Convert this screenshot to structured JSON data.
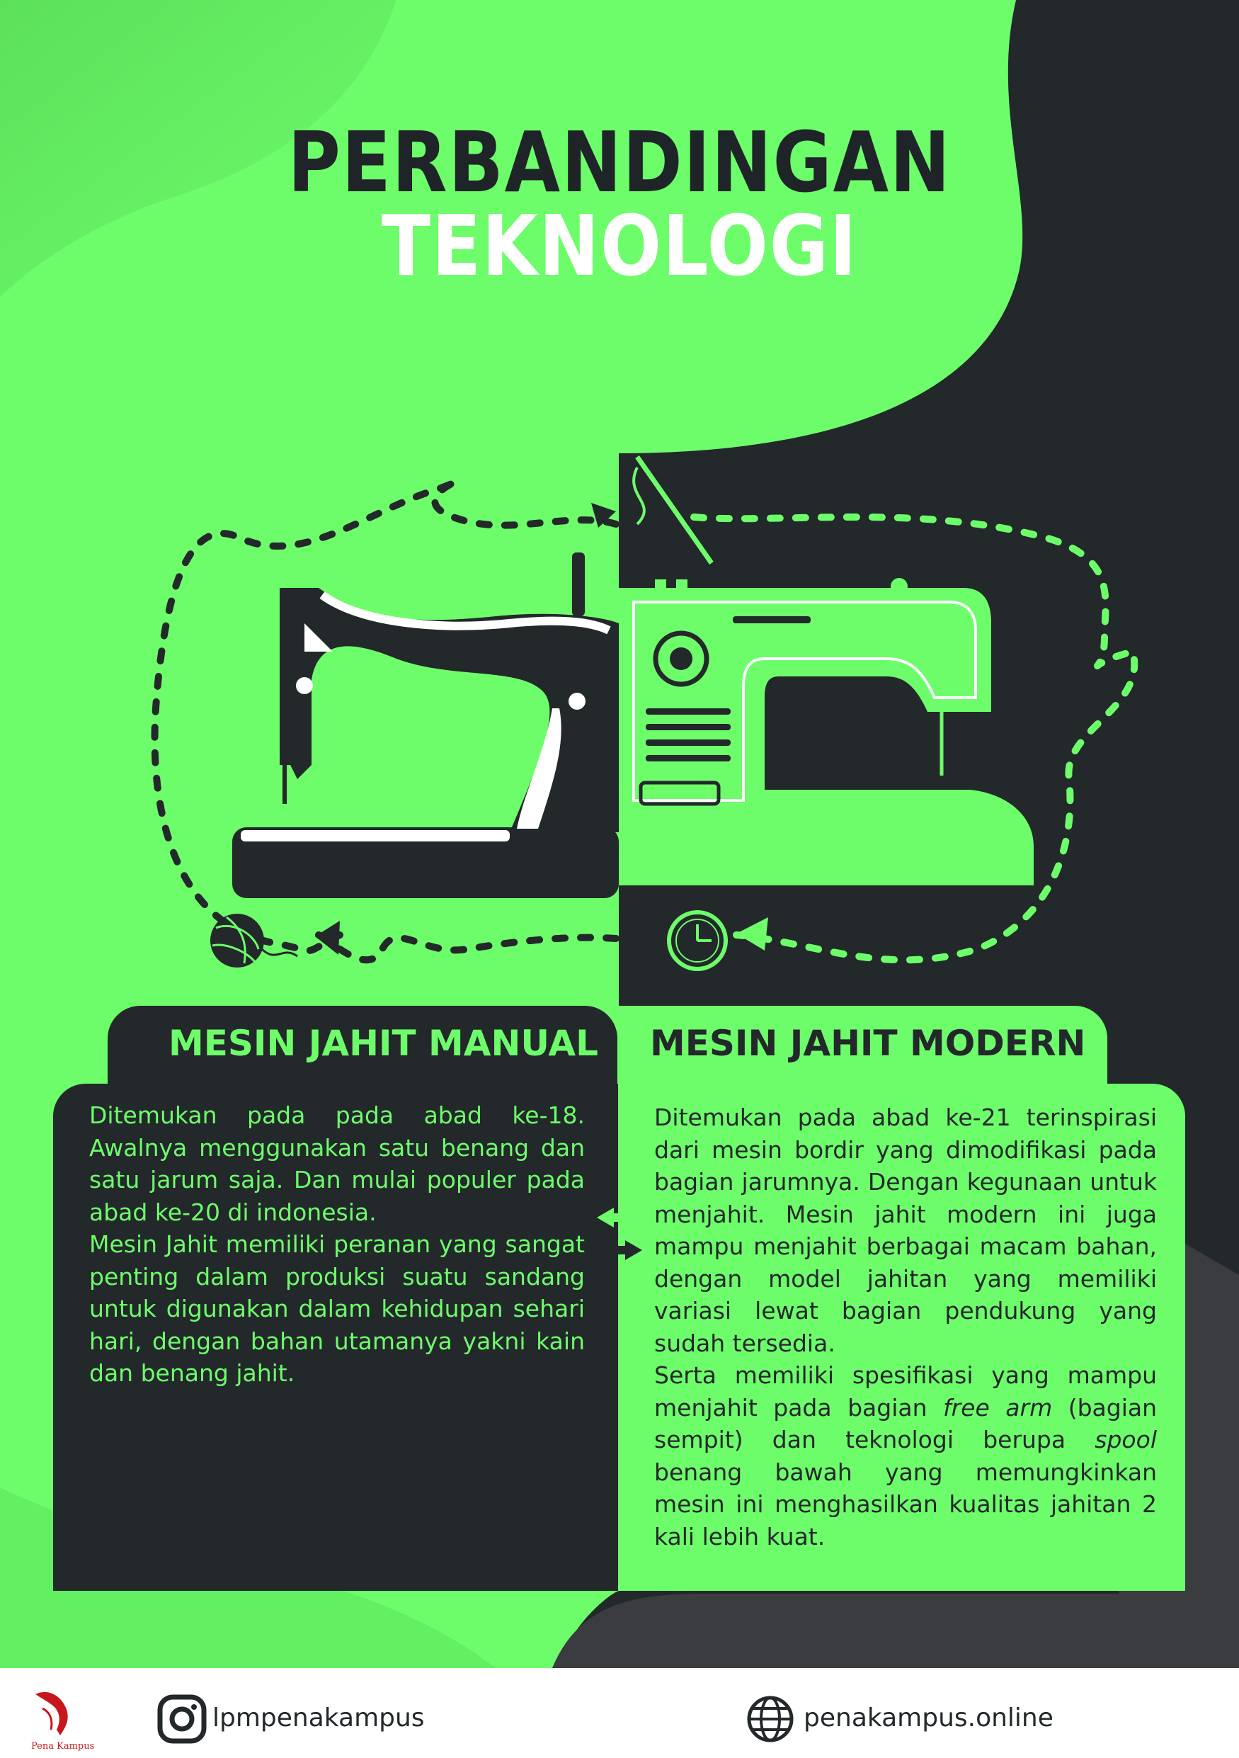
{
  "title": {
    "part1": "PERBANDINGAN",
    "part2": "TEKNOLOGI"
  },
  "manual": {
    "heading": "MESIN JAHIT MANUAL",
    "paragraphs": [
      "Ditemukan pada pada abad ke-18. Awalnya menggunakan satu benang dan satu jarum saja. Dan mulai populer pada abad ke-20 di indonesia.",
      "Mesin Jahit memiliki peranan yang sangat penting dalam produksi suatu sandang untuk digunakan dalam kehidupan sehari hari, dengan bahan utamanya yakni kain dan benang jahit."
    ]
  },
  "modern": {
    "heading": "MESIN JAHIT MODERN",
    "p1": "Ditemukan pada abad ke-21 terinspirasi dari mesin bordir yang dimodifikasi pada bagian jarumnya. Dengan kegunaan untuk menjahit. Mesin jahit modern ini juga mampu menjahit berbagai macam bahan, dengan model jahitan yang memiliki variasi lewat bagian pendukung yang sudah tersedia.",
    "p2_a": "Serta memiliki spesifikasi yang mampu menjahit pada bagian ",
    "p2_em1": "free arm",
    "p2_b": " (bagian sempit) dan teknologi berupa ",
    "p2_em2": "spool",
    "p2_c": " benang bawah yang memungkinkan mesin ini menghasilkan kualitas jahitan 2 kali lebih kuat."
  },
  "footer": {
    "instagram": "lpmpenakampus",
    "website": "penakampus.online",
    "logo_text": "Pena Kampus"
  },
  "colors": {
    "green": "#6dfd6b",
    "dark": "#23282a",
    "white": "#ffffff"
  }
}
